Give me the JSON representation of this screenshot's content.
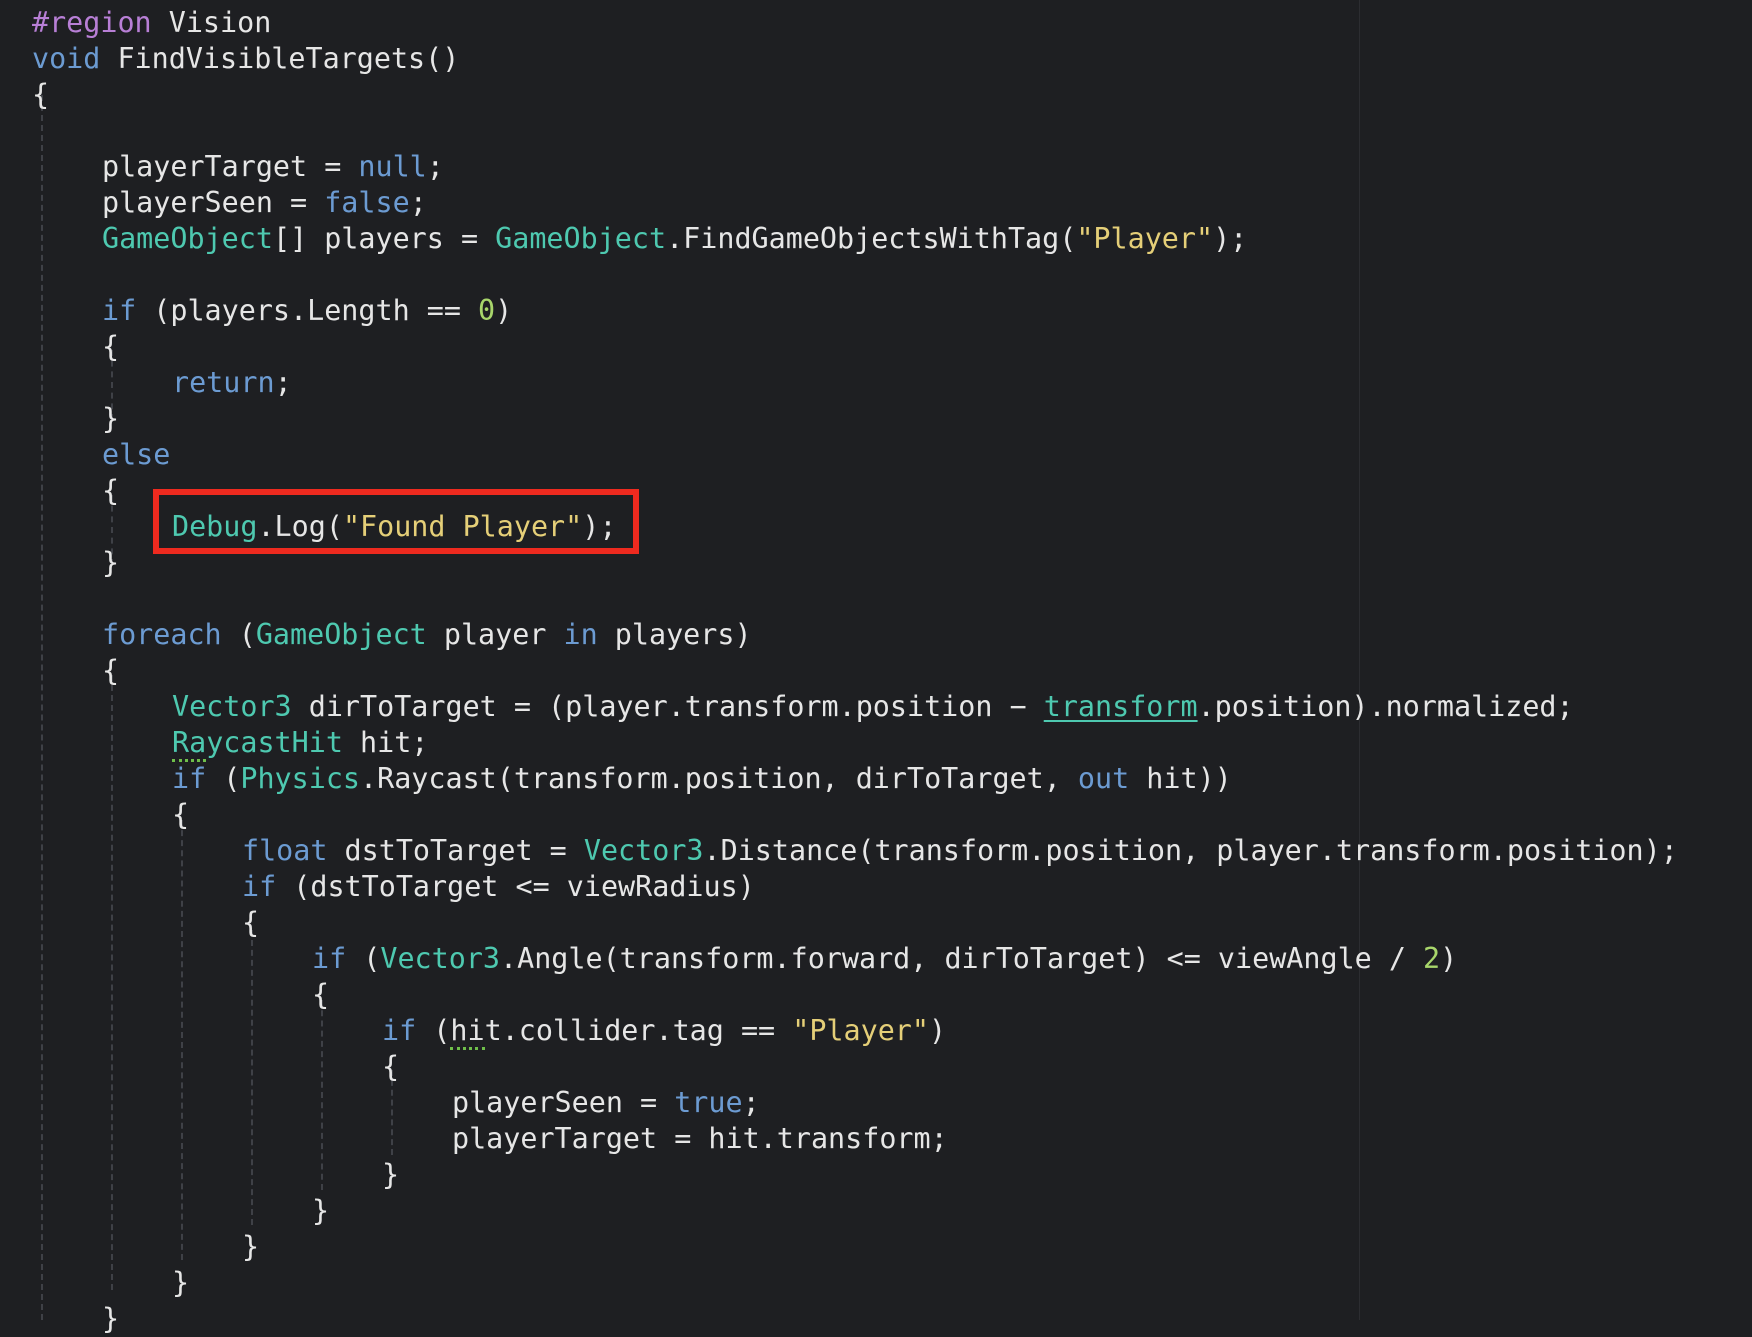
{
  "editor": {
    "highlight_color": "#ee2a1f",
    "lines": [
      {
        "indent": 0,
        "tokens": [
          {
            "t": "#region",
            "c": "prep"
          },
          {
            "t": " Vision",
            "c": "plain"
          }
        ]
      },
      {
        "indent": 0,
        "tokens": [
          {
            "t": "void",
            "c": "kw"
          },
          {
            "t": " FindVisibleTargets()",
            "c": "plain"
          }
        ]
      },
      {
        "indent": 0,
        "tokens": [
          {
            "t": "{",
            "c": "plain"
          }
        ]
      },
      {
        "indent": 0,
        "tokens": []
      },
      {
        "indent": 1,
        "tokens": [
          {
            "t": "playerTarget = ",
            "c": "plain"
          },
          {
            "t": "null",
            "c": "kw"
          },
          {
            "t": ";",
            "c": "plain"
          }
        ]
      },
      {
        "indent": 1,
        "tokens": [
          {
            "t": "playerSeen = ",
            "c": "plain"
          },
          {
            "t": "false",
            "c": "kw"
          },
          {
            "t": ";",
            "c": "plain"
          }
        ]
      },
      {
        "indent": 1,
        "tokens": [
          {
            "t": "GameObject",
            "c": "type"
          },
          {
            "t": "[] players = ",
            "c": "plain"
          },
          {
            "t": "GameObject",
            "c": "type"
          },
          {
            "t": ".FindGameObjectsWithTag(",
            "c": "plain"
          },
          {
            "t": "\"Player\"",
            "c": "str"
          },
          {
            "t": ");",
            "c": "plain"
          }
        ]
      },
      {
        "indent": 0,
        "tokens": []
      },
      {
        "indent": 1,
        "tokens": [
          {
            "t": "if",
            "c": "kw"
          },
          {
            "t": " (players.Length == ",
            "c": "plain"
          },
          {
            "t": "0",
            "c": "num"
          },
          {
            "t": ")",
            "c": "plain"
          }
        ]
      },
      {
        "indent": 1,
        "tokens": [
          {
            "t": "{",
            "c": "plain"
          }
        ]
      },
      {
        "indent": 2,
        "tokens": [
          {
            "t": "return",
            "c": "kw"
          },
          {
            "t": ";",
            "c": "plain"
          }
        ]
      },
      {
        "indent": 1,
        "tokens": [
          {
            "t": "}",
            "c": "plain"
          }
        ]
      },
      {
        "indent": 1,
        "tokens": [
          {
            "t": "else",
            "c": "kw"
          }
        ]
      },
      {
        "indent": 1,
        "tokens": [
          {
            "t": "{",
            "c": "plain"
          }
        ]
      },
      {
        "indent": 2,
        "tokens": [
          {
            "t": "Debug",
            "c": "type"
          },
          {
            "t": ".Log(",
            "c": "plain"
          },
          {
            "t": "\"Found Player\"",
            "c": "str"
          },
          {
            "t": ");",
            "c": "plain"
          }
        ],
        "highlighted": true
      },
      {
        "indent": 1,
        "tokens": [
          {
            "t": "}",
            "c": "plain"
          }
        ]
      },
      {
        "indent": 0,
        "tokens": []
      },
      {
        "indent": 1,
        "tokens": [
          {
            "t": "foreach",
            "c": "kw"
          },
          {
            "t": " (",
            "c": "plain"
          },
          {
            "t": "GameObject",
            "c": "type"
          },
          {
            "t": " player ",
            "c": "plain"
          },
          {
            "t": "in",
            "c": "kw"
          },
          {
            "t": " players)",
            "c": "plain"
          }
        ]
      },
      {
        "indent": 1,
        "tokens": [
          {
            "t": "{",
            "c": "plain"
          }
        ]
      },
      {
        "indent": 2,
        "tokens": [
          {
            "t": "Vector3",
            "c": "type"
          },
          {
            "t": " dirToTarget = (player.transform.position − ",
            "c": "plain"
          },
          {
            "t": "transform",
            "c": "link"
          },
          {
            "t": ".position).normalized;",
            "c": "plain"
          }
        ]
      },
      {
        "indent": 2,
        "tokens": [
          {
            "t": "RaycastHit",
            "c": "type",
            "sq": "first"
          },
          {
            "t": " hit;",
            "c": "plain"
          }
        ]
      },
      {
        "indent": 2,
        "tokens": [
          {
            "t": "if",
            "c": "kw"
          },
          {
            "t": " (",
            "c": "plain"
          },
          {
            "t": "Physics",
            "c": "type"
          },
          {
            "t": ".Raycast(transform.position, dirToTarget, ",
            "c": "plain"
          },
          {
            "t": "out",
            "c": "kw"
          },
          {
            "t": " hit))",
            "c": "plain"
          }
        ]
      },
      {
        "indent": 2,
        "tokens": [
          {
            "t": "{",
            "c": "plain"
          }
        ]
      },
      {
        "indent": 3,
        "tokens": [
          {
            "t": "float",
            "c": "kw"
          },
          {
            "t": " dstToTarget = ",
            "c": "plain"
          },
          {
            "t": "Vector3",
            "c": "type"
          },
          {
            "t": ".Distance(transform.position, player.transform.position);",
            "c": "plain"
          }
        ]
      },
      {
        "indent": 3,
        "tokens": [
          {
            "t": "if",
            "c": "kw"
          },
          {
            "t": " (dstToTarget <= viewRadius)",
            "c": "plain"
          }
        ]
      },
      {
        "indent": 3,
        "tokens": [
          {
            "t": "{",
            "c": "plain"
          }
        ]
      },
      {
        "indent": 4,
        "tokens": [
          {
            "t": "if",
            "c": "kw"
          },
          {
            "t": " (",
            "c": "plain"
          },
          {
            "t": "Vector3",
            "c": "type"
          },
          {
            "t": ".Angle(transform.forward, dirToTarget) <= viewAngle / ",
            "c": "plain"
          },
          {
            "t": "2",
            "c": "num"
          },
          {
            "t": ")",
            "c": "plain"
          }
        ]
      },
      {
        "indent": 4,
        "tokens": [
          {
            "t": "{",
            "c": "plain"
          }
        ]
      },
      {
        "indent": 5,
        "tokens": [
          {
            "t": "if",
            "c": "kw"
          },
          {
            "t": " (",
            "c": "plain"
          },
          {
            "t": "hi",
            "c": "plain",
            "sq": "all"
          },
          {
            "t": "t.collider.tag == ",
            "c": "plain"
          },
          {
            "t": "\"Player\"",
            "c": "str"
          },
          {
            "t": ")",
            "c": "plain"
          }
        ]
      },
      {
        "indent": 5,
        "tokens": [
          {
            "t": "{",
            "c": "plain"
          }
        ]
      },
      {
        "indent": 6,
        "tokens": [
          {
            "t": "playerSeen = ",
            "c": "plain"
          },
          {
            "t": "true",
            "c": "kw"
          },
          {
            "t": ";",
            "c": "plain"
          }
        ]
      },
      {
        "indent": 6,
        "tokens": [
          {
            "t": "playerTarget = hit.transform;",
            "c": "plain"
          }
        ]
      },
      {
        "indent": 5,
        "tokens": [
          {
            "t": "}",
            "c": "plain"
          }
        ]
      },
      {
        "indent": 4,
        "tokens": [
          {
            "t": "}",
            "c": "plain"
          }
        ]
      },
      {
        "indent": 3,
        "tokens": [
          {
            "t": "}",
            "c": "plain"
          }
        ]
      },
      {
        "indent": 2,
        "tokens": [
          {
            "t": "}",
            "c": "plain"
          }
        ]
      },
      {
        "indent": 1,
        "tokens": [
          {
            "t": "}",
            "c": "plain"
          }
        ]
      }
    ]
  }
}
